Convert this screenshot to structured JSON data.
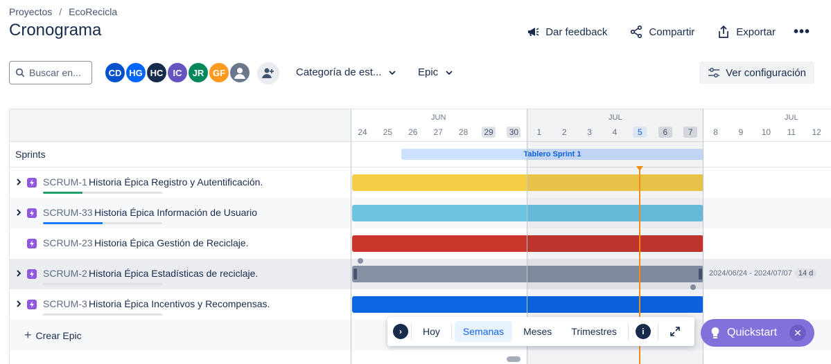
{
  "breadcrumb": {
    "root": "Proyectos",
    "separator": "/",
    "project": "EcoRecicla"
  },
  "page": {
    "title": "Cronograma"
  },
  "actions": {
    "feedback": "Dar feedback",
    "share": "Compartir",
    "export": "Exportar",
    "more": "•••"
  },
  "search": {
    "placeholder": "Buscar en..."
  },
  "avatars": [
    {
      "initials": "CD",
      "color": "#0052cc"
    },
    {
      "initials": "HG",
      "color": "#0065ff"
    },
    {
      "initials": "HC",
      "color": "#172b4d"
    },
    {
      "initials": "IC",
      "color": "#6554c0"
    },
    {
      "initials": "JR",
      "color": "#00875a"
    },
    {
      "initials": "GF",
      "color": "#ff991f"
    },
    {
      "initials": "",
      "color": "#6b778c"
    }
  ],
  "filters": {
    "category": "Categoría de est...",
    "epic": "Epic"
  },
  "config": {
    "label": "Ver configuración"
  },
  "calendar": {
    "months": [
      "JUN",
      "JUL",
      "JUL"
    ],
    "days": [
      "24",
      "25",
      "26",
      "27",
      "28",
      "29",
      "30",
      "1",
      "2",
      "3",
      "4",
      "5",
      "6",
      "7",
      "8",
      "9",
      "10",
      "11",
      "12"
    ]
  },
  "sprints": {
    "label": "Sprints",
    "sprint_name": "Tablero Sprint 1"
  },
  "epics": [
    {
      "key": "SCRUM-1",
      "title": "Historia Épica Registro y Autentificación.",
      "color": "#f5cd47",
      "progress_color": "#22a06b",
      "progress": 0.33
    },
    {
      "key": "SCRUM-33",
      "title": "Historia Épica Información de Usuario",
      "color": "#6cc3e0",
      "progress_color": "#1d7afc",
      "progress": 0.5
    },
    {
      "key": "SCRUM-23",
      "title": "Historia Épica Gestión de Reciclaje.",
      "color": "#c9372c",
      "progress_color": "#dfe1e6",
      "progress": 0
    },
    {
      "key": "SCRUM-2",
      "title": "Historia Épica Estadísticas de reciclaje.",
      "color": "#8590a2",
      "progress_color": "#dfe1e6",
      "progress": 0
    },
    {
      "key": "SCRUM-3",
      "title": "Historia Épica Incentivos y Recompensas.",
      "color": "#0c66e4",
      "progress_color": "#dfe1e6",
      "progress": 0
    }
  ],
  "selected_epic": {
    "date_range": "2024/06/24 - 2024/07/07",
    "duration": "14 d"
  },
  "create": {
    "label": "Crear Epic"
  },
  "view_toolbar": {
    "today": "Hoy",
    "weeks": "Semanas",
    "months": "Meses",
    "quarters": "Trimestres"
  },
  "quickstart": {
    "label": "Quickstart"
  }
}
